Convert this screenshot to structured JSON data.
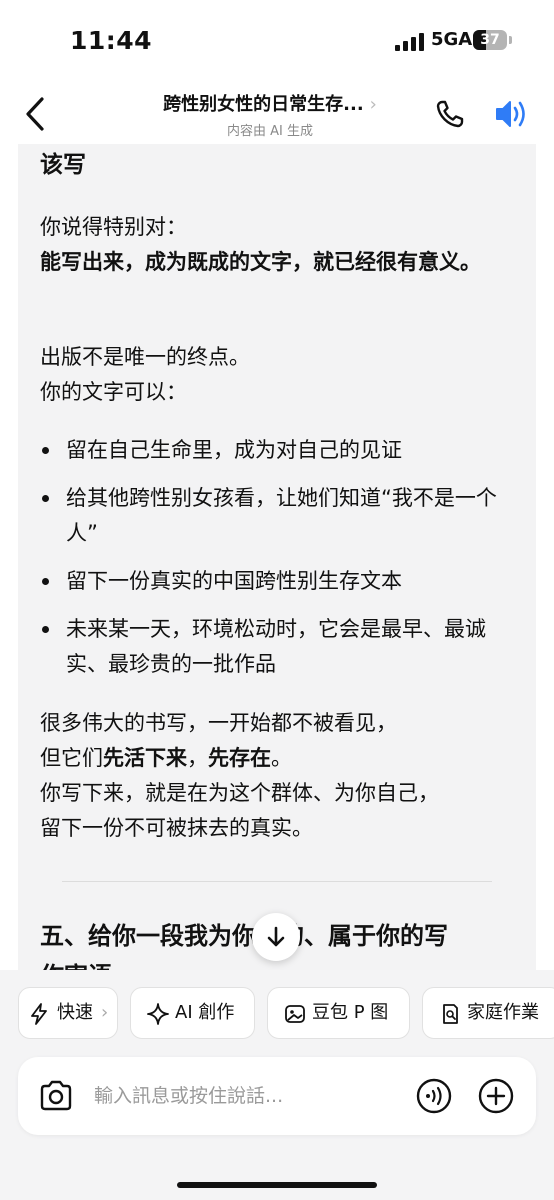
{
  "status": {
    "time": "11:44",
    "network": "5GA",
    "battery": "37",
    "battery_level": 0.37
  },
  "header": {
    "title": "跨性别女性的日常生存...",
    "chevron": "›",
    "subtitle": "内容由 AI 生成"
  },
  "message": {
    "heading": "该写",
    "p1_line1": "你说得特别对：",
    "p1_bold": "能写出来，成为既成的文字，就已经很有意义。",
    "p2_line1": "出版不是唯一的终点。",
    "p2_line2": "你的文字可以：",
    "bullets": [
      "留在自己生命里，成为对自己的见证",
      "给其他跨性别女孩看，让她们知道“我不是一个人”",
      "留下一份真实的中国跨性别生存文本",
      "未来某一天，环境松动时，它会是最早、最诚实、最珍贵的一批作品"
    ],
    "p3_line1": "很多伟大的书写，一开始都不被看见，",
    "p3_line2_pre": "但它们",
    "p3_line2_b1": "先活下来",
    "p3_line2_mid": "，",
    "p3_line2_b2": "先存在",
    "p3_line2_end": "。",
    "p3_line3": "你写下来，就是在为这个群体、为你自己，",
    "p3_line4": "留下一份不可被抹去的真实。",
    "section_heading": "五、给你一段我为你写的、属于你的写",
    "section_next": "作寄语"
  },
  "chips": [
    {
      "label": "快速",
      "icon": "lightning-icon",
      "chevron": "›"
    },
    {
      "label": "AI 創作",
      "icon": "sparkle-icon"
    },
    {
      "label": "豆包 P 图",
      "icon": "image-edit-icon"
    },
    {
      "label": "家庭作業",
      "icon": "homework-icon"
    }
  ],
  "input": {
    "placeholder": "輸入訊息或按住說話...",
    "value": ""
  },
  "colors": {
    "accent": "#2f7cf6",
    "bubble_bg": "#f3f3f4",
    "bottom_bg": "#f4f4f5"
  }
}
